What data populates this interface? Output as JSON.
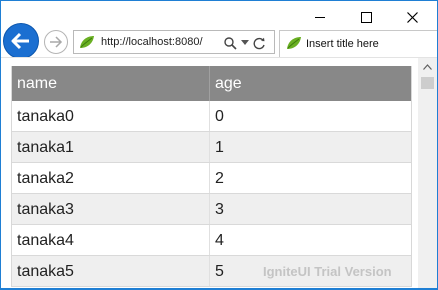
{
  "window": {
    "controls": {
      "minimize": "—",
      "maximize": "□",
      "close": "✕"
    }
  },
  "nav": {
    "back_icon": "back-arrow-icon",
    "forward_icon": "forward-arrow-icon"
  },
  "address": {
    "url": "http://localhost:8080/",
    "favicon": "leaf-icon",
    "search_icon": "search-icon",
    "dropdown_icon": "chevron-down-icon",
    "refresh_icon": "refresh-icon"
  },
  "tab": {
    "title": "Insert title here",
    "favicon": "leaf-icon"
  },
  "grid": {
    "columns": [
      "name",
      "age"
    ],
    "rows": [
      {
        "name": "tanaka0",
        "age": "0"
      },
      {
        "name": "tanaka1",
        "age": "1"
      },
      {
        "name": "tanaka2",
        "age": "2"
      },
      {
        "name": "tanaka3",
        "age": "3"
      },
      {
        "name": "tanaka4",
        "age": "4"
      },
      {
        "name": "tanaka5",
        "age": "5"
      }
    ]
  },
  "watermark": "IgniteUI Trial Version",
  "colors": {
    "header_bg": "#888888",
    "accent": "#1b6fd1",
    "row_alt": "#efefef"
  }
}
